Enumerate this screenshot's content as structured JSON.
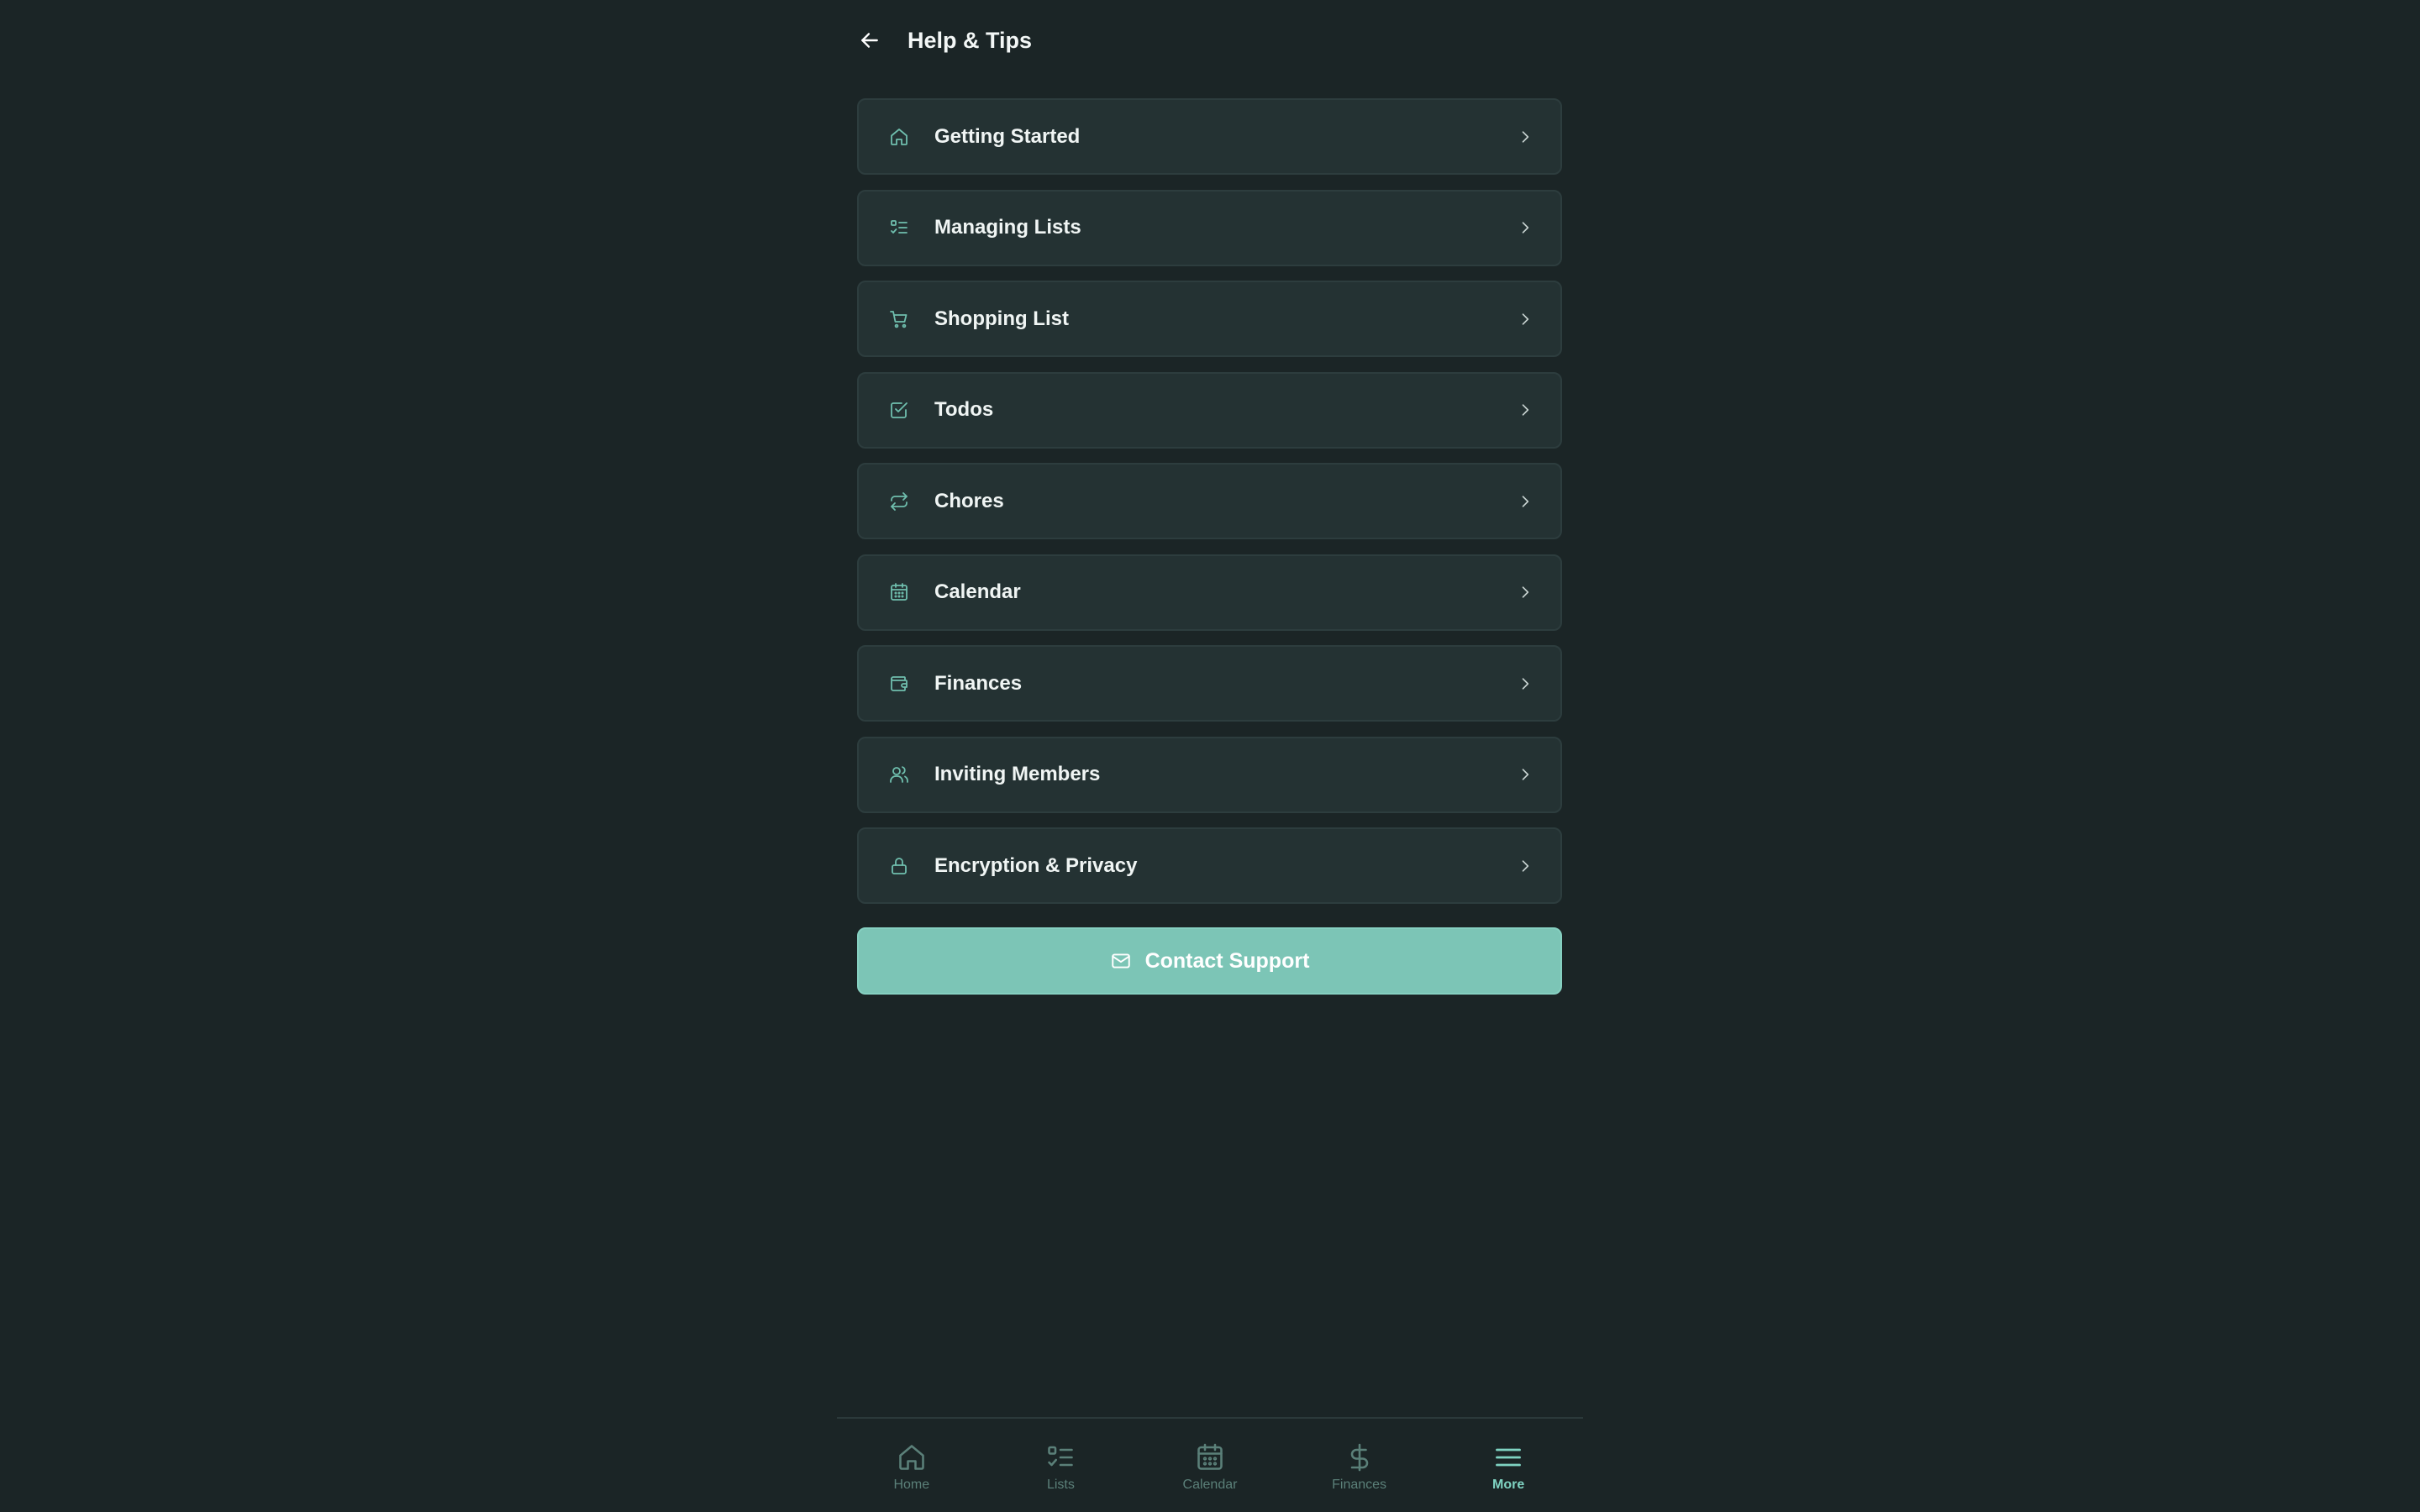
{
  "header": {
    "title": "Help & Tips",
    "back_icon": "arrow-left-icon"
  },
  "help_items": [
    {
      "label": "Getting Started",
      "icon": "home-icon"
    },
    {
      "label": "Managing Lists",
      "icon": "list-check-icon"
    },
    {
      "label": "Shopping List",
      "icon": "shopping-cart-icon"
    },
    {
      "label": "Todos",
      "icon": "checkbox-icon"
    },
    {
      "label": "Chores",
      "icon": "repeat-icon"
    },
    {
      "label": "Calendar",
      "icon": "calendar-icon"
    },
    {
      "label": "Finances",
      "icon": "wallet-icon"
    },
    {
      "label": "Inviting Members",
      "icon": "users-icon"
    },
    {
      "label": "Encryption & Privacy",
      "icon": "lock-icon"
    }
  ],
  "contact_button": {
    "label": "Contact Support",
    "icon": "mail-icon"
  },
  "bottom_nav": [
    {
      "label": "Home",
      "icon": "home-icon",
      "active": false
    },
    {
      "label": "Lists",
      "icon": "list-check-icon",
      "active": false
    },
    {
      "label": "Calendar",
      "icon": "calendar-icon",
      "active": false
    },
    {
      "label": "Finances",
      "icon": "dollar-icon",
      "active": false
    },
    {
      "label": "More",
      "icon": "menu-icon",
      "active": true
    }
  ],
  "colors": {
    "background": "#1b2526",
    "card": "#243233",
    "accent": "#7cc5b6",
    "icon_accent": "#6fbfae",
    "nav_inactive": "#5b8079",
    "nav_active": "#7fd3c2"
  }
}
